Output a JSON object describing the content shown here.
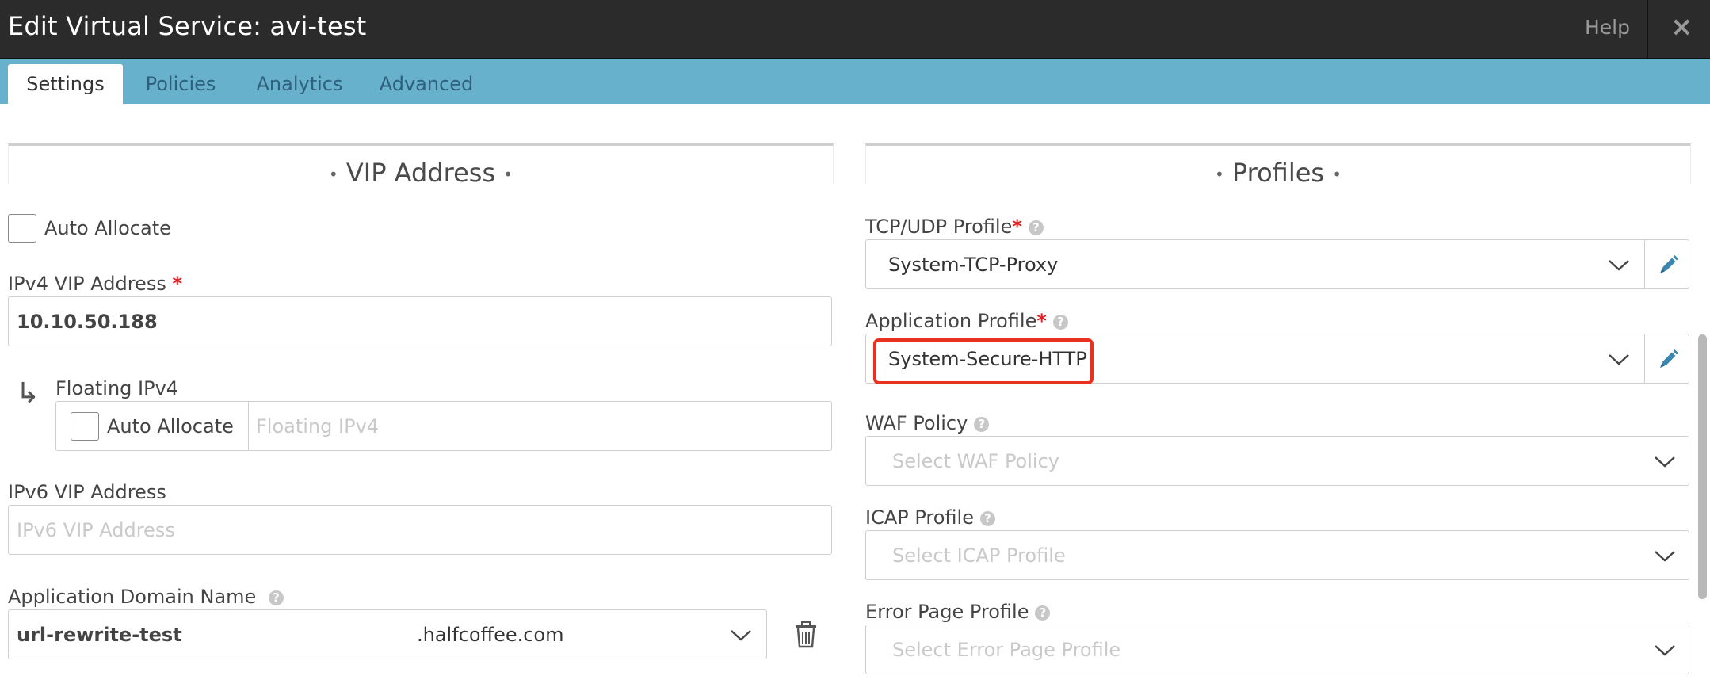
{
  "window": {
    "title": "Edit Virtual Service: avi-test",
    "help_label": "Help",
    "close_label": "×"
  },
  "tabs": [
    {
      "label": "Settings",
      "active": true
    },
    {
      "label": "Policies",
      "active": false
    },
    {
      "label": "Analytics",
      "active": false
    },
    {
      "label": "Advanced",
      "active": false
    }
  ],
  "vip": {
    "section_title": "VIP Address",
    "auto_allocate_label": "Auto Allocate",
    "auto_allocate_checked": false,
    "ipv4_label": "IPv4 VIP Address",
    "ipv4_value": "10.10.50.188",
    "floating_label": "Floating IPv4",
    "floating_auto_allocate_label": "Auto Allocate",
    "floating_auto_allocate_checked": false,
    "floating_placeholder": "Floating IPv4",
    "ipv6_label": "IPv6 VIP Address",
    "ipv6_placeholder": "IPv6 VIP Address",
    "domain_label": "Application Domain Name",
    "domain_name_value": "url-rewrite-test",
    "domain_suffix_value": ".halfcoffee.com"
  },
  "profiles": {
    "section_title": "Profiles",
    "tcp_udp_label": "TCP/UDP Profile",
    "tcp_udp_value": "System-TCP-Proxy",
    "app_profile_label": "Application Profile",
    "app_profile_value": "System-Secure-HTTP",
    "waf_label": "WAF Policy",
    "waf_placeholder": "Select WAF Policy",
    "icap_label": "ICAP Profile",
    "icap_placeholder": "Select ICAP Profile",
    "error_page_label": "Error Page Profile",
    "error_page_placeholder": "Select Error Page Profile"
  },
  "symbols": {
    "required": "*",
    "help": "?",
    "dot": "•",
    "return_arrow": "↳"
  },
  "colors": {
    "titlebar_bg": "#2b2b2b",
    "tabbar_bg": "#67b1cd",
    "required": "#e02020",
    "highlight": "#e8321f",
    "edit_icon": "#3a86b0"
  },
  "icons": [
    "close-icon",
    "help-icon",
    "chevron-down-icon",
    "pencil-icon",
    "trash-icon",
    "return-arrow-icon"
  ]
}
